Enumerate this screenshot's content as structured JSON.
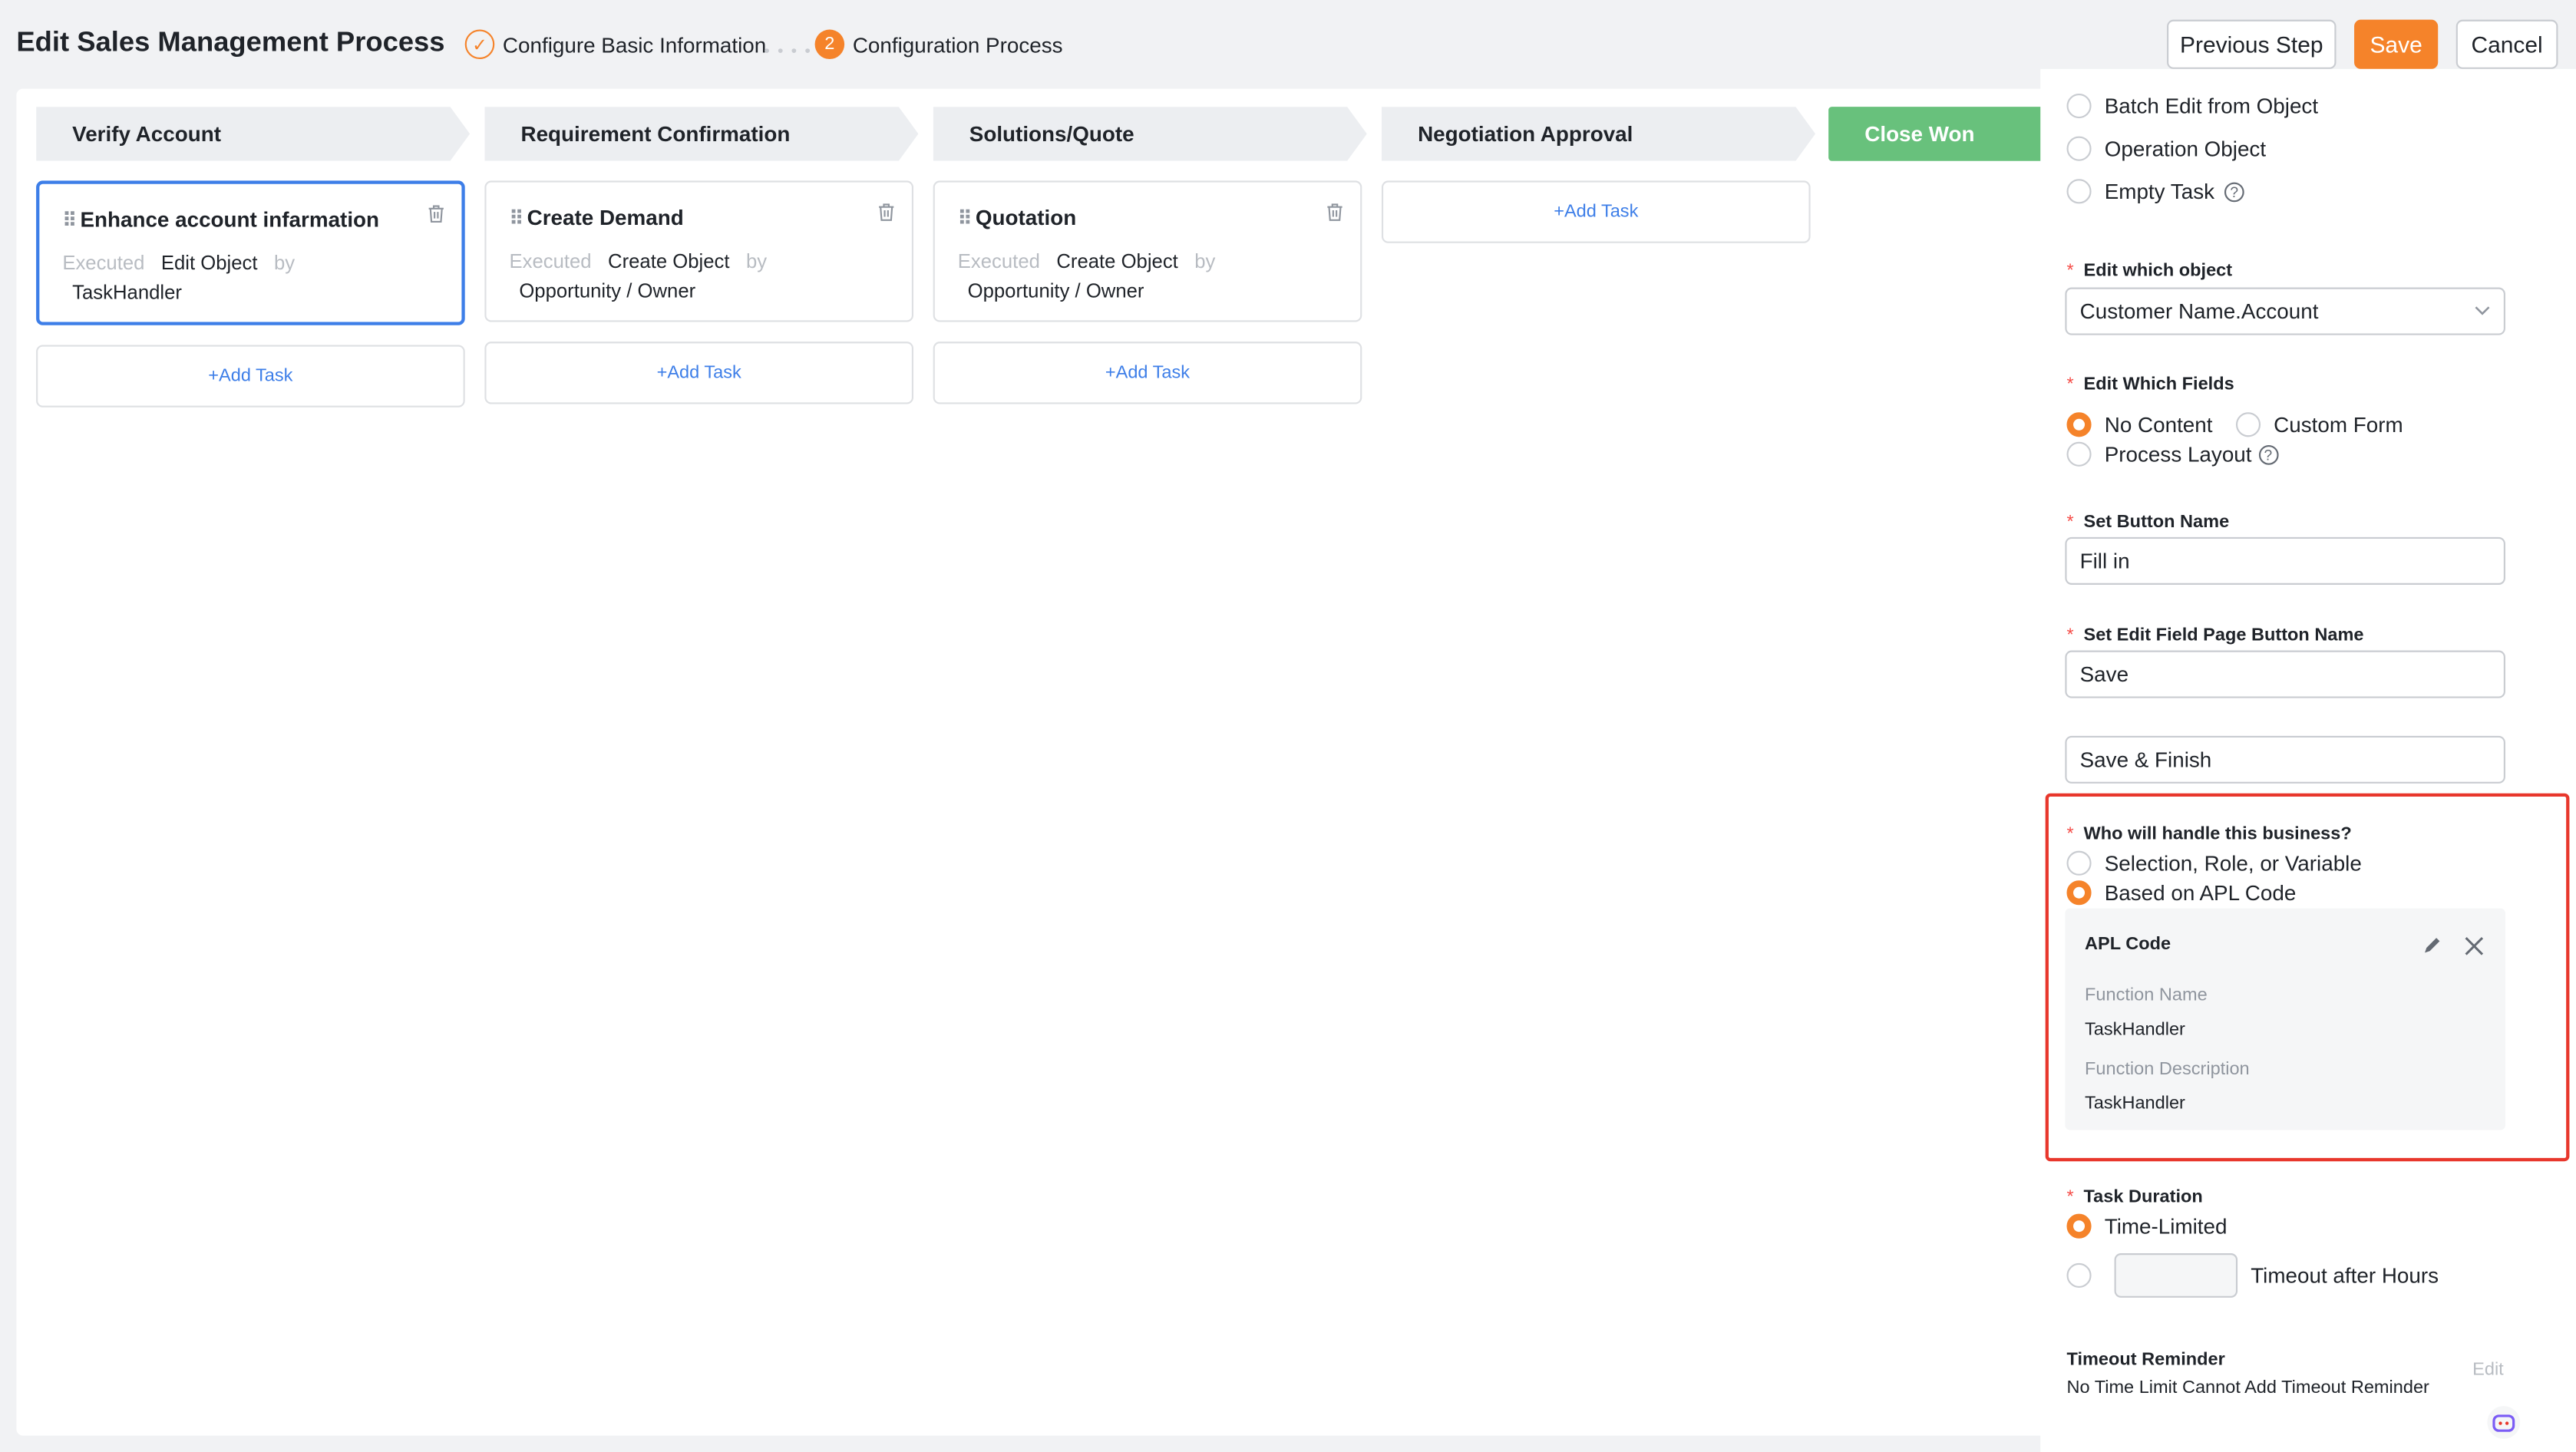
{
  "header": {
    "title": "Edit Sales Management Process",
    "steps": [
      "Configure Basic Information",
      "Configuration Process"
    ],
    "step2_number": "2",
    "buttons": {
      "previous": "Previous Step",
      "save": "Save",
      "cancel": "Cancel"
    }
  },
  "stages": [
    "Verify Account",
    "Requirement Confirmation",
    "Solutions/Quote",
    "Negotiation Approval",
    "Close Won"
  ],
  "tasks": [
    {
      "title": "Enhance account infarmation",
      "executed": "Executed",
      "action": "Edit Object",
      "by": "by",
      "handler": "TaskHandler"
    },
    {
      "title": "Create Demand",
      "executed": "Executed",
      "action": "Create Object",
      "by": "by",
      "handler": "Opportunity / Owner"
    },
    {
      "title": "Quotation",
      "executed": "Executed",
      "action": "Create Object",
      "by": "by",
      "handler": "Opportunity / Owner"
    }
  ],
  "add_task_label": "+Add Task",
  "panel": {
    "task_types": [
      "Batch Edit from Object",
      "Operation Object",
      "Empty Task"
    ],
    "edit_object_label": "Edit which object",
    "edit_object_value": "Customer Name.Account",
    "edit_fields_label": "Edit Which Fields",
    "edit_fields_options": [
      "No Content",
      "Custom Form",
      "Process Layout"
    ],
    "button_name_label": "Set Button Name",
    "button_name_value": "Fill in",
    "edit_page_button_label": "Set Edit Field Page Button Name",
    "edit_page_button_value1": "Save",
    "edit_page_button_value2": "Save & Finish",
    "handler_label": "Who will handle this business?",
    "handler_options": [
      "Selection, Role, or Variable",
      "Based on APL Code"
    ],
    "apl": {
      "title": "APL Code",
      "function_name_label": "Function Name",
      "function_name": "TaskHandler",
      "function_desc_label": "Function Description",
      "function_desc": "TaskHandler"
    },
    "duration_label": "Task Duration",
    "duration_options": [
      "Time-Limited",
      "Timeout after Hours"
    ],
    "reminder_label": "Timeout Reminder",
    "reminder_text": "No Time Limit Cannot Add Timeout Reminder",
    "reminder_edit": "Edit",
    "required_mark": "*"
  }
}
